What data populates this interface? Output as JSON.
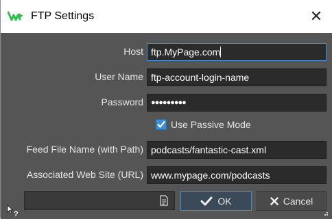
{
  "window": {
    "title": "FTP Settings",
    "app_icon": "wavelab-icon",
    "close_glyph": "✕"
  },
  "form": {
    "host": {
      "label": "Host",
      "value": "ftp.MyPage.com"
    },
    "username": {
      "label": "User Name",
      "value": "ftp-account-login-name"
    },
    "password": {
      "label": "Password",
      "value": "●●●●●●●●●"
    },
    "passive": {
      "label": "Use Passive Mode",
      "checked": true
    },
    "feed_file": {
      "label": "Feed File Name (with Path)",
      "value": "podcasts/fantastic-cast.xml"
    },
    "website": {
      "label": "Associated Web Site (URL)",
      "value": "www.mypage.com/podcasts"
    }
  },
  "footer": {
    "preset_path": "",
    "ok_label": "OK",
    "cancel_label": "Cancel",
    "help_icon": "whats-this-help-icon"
  },
  "colors": {
    "panel": "#555555",
    "field_bg": "#2b2b2b",
    "accent": "#3d8fd6",
    "app_icon": "#2fbf4f"
  }
}
